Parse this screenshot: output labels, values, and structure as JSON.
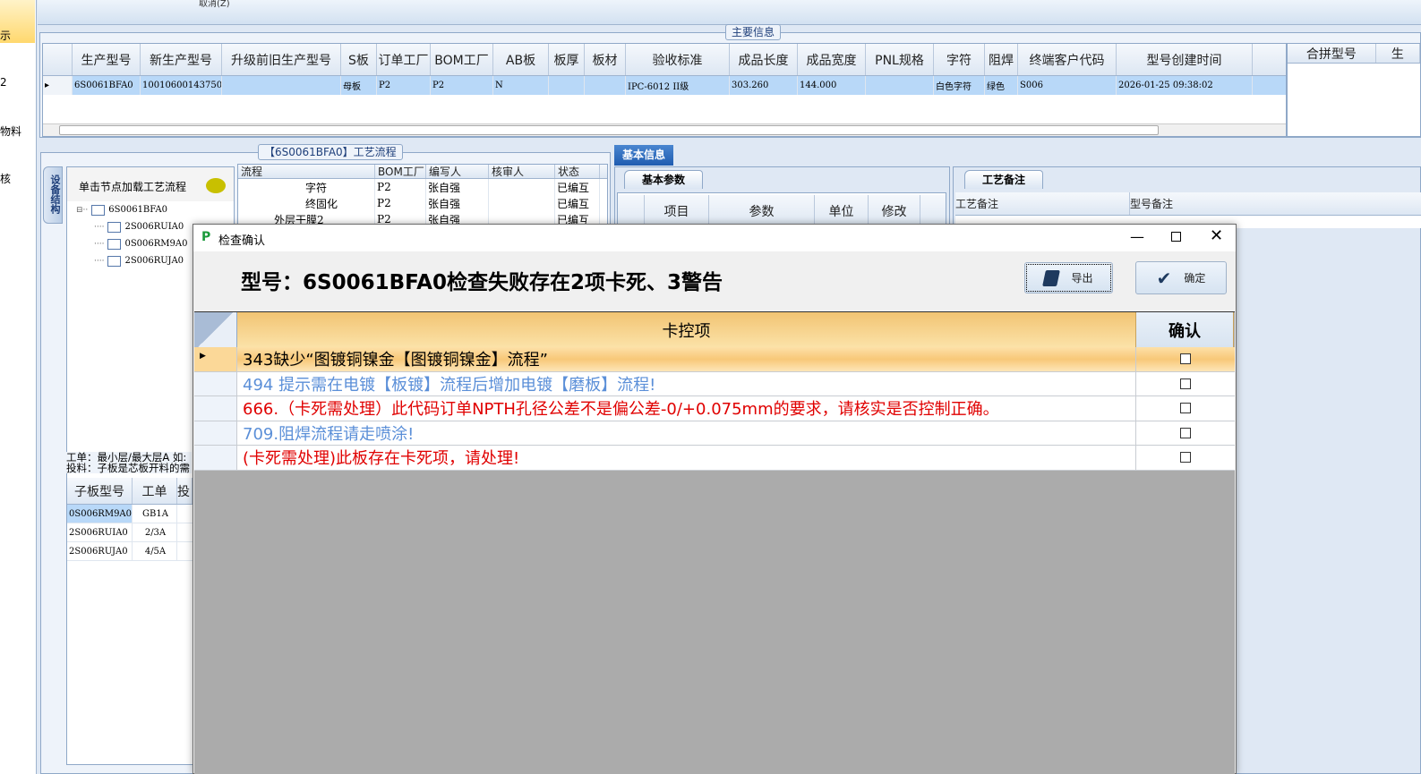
{
  "sidebar": {
    "items": [
      "示",
      "2",
      "物料",
      "核"
    ]
  },
  "toolbar": {
    "cancel_label": "取消(Z)"
  },
  "main_info": {
    "legend": "主要信息",
    "columns": [
      "生产型号",
      "新生产型号",
      "升级前旧生产型号",
      "S板",
      "订单工厂",
      "BOM工厂",
      "AB板",
      "板厚",
      "板材",
      "验收标准",
      "成品长度",
      "成品宽度",
      "PNL规格",
      "字符",
      "阻焊",
      "终端客户代码",
      "型号创建时间"
    ],
    "row": [
      "6S0061BFA0",
      "10010600143750",
      "",
      "母板",
      "P2",
      "P2",
      "N",
      "",
      "",
      "IPC-6012 II级",
      "303.260",
      "144.000",
      "",
      "白色字符",
      "绿色",
      "S006",
      "2026-01-25 09:38:02"
    ],
    "side_columns": [
      "合拼型号",
      "生"
    ]
  },
  "process": {
    "legend": "【6S0061BFA0】工艺流程",
    "vertical_tab": "设备结构",
    "tree_header": "单击节点加载工艺流程",
    "tree": [
      "6S0061BFA0",
      "2S006RUIA0",
      "0S006RM9A0",
      "2S006RUJA0"
    ],
    "columns": [
      "流程",
      "BOM工厂",
      "编写人",
      "核审人",
      "状态"
    ],
    "rows": [
      [
        "字符",
        "P2",
        "张自强",
        "",
        "已编互"
      ],
      [
        "终固化",
        "P2",
        "张自强",
        "",
        "已编互"
      ],
      [
        "外层干膜2",
        "P2",
        "张自强",
        "",
        "已编互"
      ]
    ],
    "note_line1": "工单：最小层/最大层A 如:",
    "note_line2": "投料：子板是芯板开料的需",
    "child_columns": [
      "子板型号",
      "工单",
      "投"
    ],
    "child_rows": [
      [
        "0S006RM9A0",
        "GB1A"
      ],
      [
        "2S006RUIA0",
        "2/3A"
      ],
      [
        "2S006RUJA0",
        "4/5A"
      ]
    ]
  },
  "basic": {
    "tab": "基本信息",
    "params_tab": "基本参数",
    "params_columns": [
      "项目",
      "参数",
      "单位",
      "修改"
    ],
    "remark_tab": "工艺备注",
    "remark_columns": [
      "工艺备注",
      "型号备注"
    ]
  },
  "dialog": {
    "title": "检查确认",
    "heading": "型号：6S0061BFA0检查失败存在2项卡死、3警告",
    "export_label": "导出",
    "ok_label": "确定",
    "columns": [
      "卡控项",
      "确认"
    ],
    "rows": [
      {
        "text": "343缺少“图镀铜镍金【图镀铜镍金】流程”",
        "color": "#000000",
        "checked": false
      },
      {
        "text": "494 提示需在电镀【板镀】流程后增加电镀【磨板】流程!",
        "color": "#5b8fd8",
        "checked": false
      },
      {
        "text": "666.（卡死需处理）此代码订单NPTH孔径公差不是偏公差-0/+0.075mm的要求，请核实是否控制正确。",
        "color": "#e00000",
        "checked": false
      },
      {
        "text": "709.阻焊流程请走喷涂!",
        "color": "#5b8fd8",
        "checked": false
      },
      {
        "text": "(卡死需处理)此板存在卡死项，请处理!",
        "color": "#e00000",
        "checked": false
      }
    ]
  }
}
